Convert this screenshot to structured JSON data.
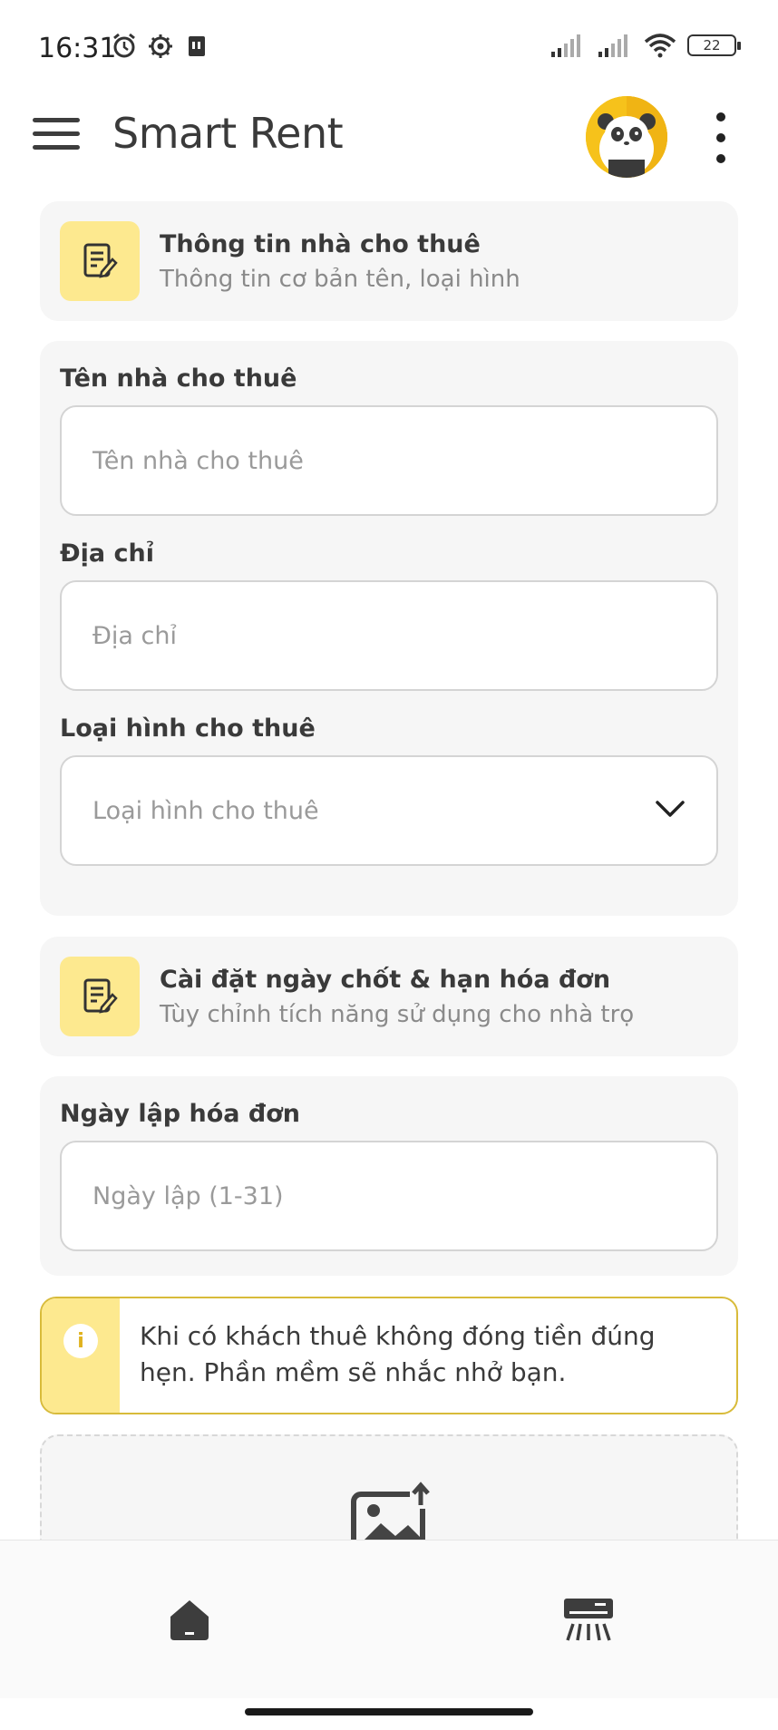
{
  "status_bar": {
    "time": "16:31",
    "battery": "22"
  },
  "app_bar": {
    "title": "Smart Rent"
  },
  "section_rental": {
    "title": "Thông tin nhà cho thuê",
    "subtitle": "Thông tin cơ bản tên, loại hình"
  },
  "form_basic": {
    "name_label": "Tên nhà cho thuê",
    "name_placeholder": "Tên nhà cho thuê",
    "address_label": "Địa chỉ",
    "address_placeholder": "Địa chỉ",
    "type_label": "Loại hình cho thuê",
    "type_placeholder": "Loại hình cho thuê"
  },
  "section_invoice": {
    "title": "Cài đặt ngày chốt & hạn hóa đơn",
    "subtitle": "Tùy chỉnh tích năng sử dụng cho nhà trọ"
  },
  "form_invoice": {
    "date_label": "Ngày lập hóa đơn",
    "date_placeholder": "Ngày lập (1-31)"
  },
  "notice": {
    "icon": "i",
    "text": "Khi có khách thuê không đóng tiền đúng hẹn. Phần mềm sẽ nhắc nhở bạn."
  },
  "colors": {
    "accent_yellow": "#fde98f",
    "notice_border": "#d8bb3a",
    "card_bg": "#f6f6f6",
    "text_dark": "#3a3a3a",
    "placeholder": "#9a9a9a"
  },
  "icons": {
    "menu": "hamburger-menu-icon",
    "more": "kebab-menu-icon",
    "section": "edit-note-icon",
    "dropdown": "chevron-down-icon",
    "upload": "image-upload-icon",
    "nav_home": "home-icon",
    "nav_ac": "air-conditioner-icon"
  }
}
